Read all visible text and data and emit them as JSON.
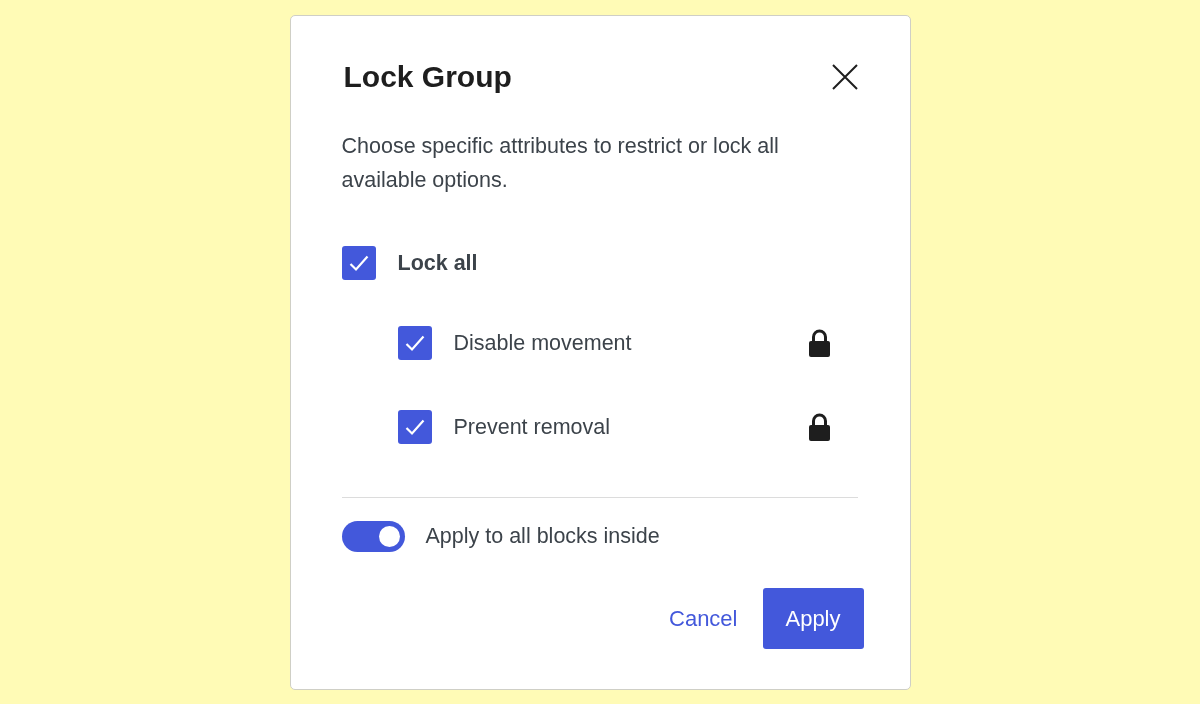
{
  "dialog": {
    "title": "Lock Group",
    "description": "Choose specific attributes to restrict or lock all available options."
  },
  "lock_all": {
    "label": "Lock all",
    "checked": true,
    "children": [
      {
        "label": "Disable movement",
        "checked": true,
        "locked": true
      },
      {
        "label": "Prevent removal",
        "checked": true,
        "locked": true
      }
    ]
  },
  "apply_to_inner": {
    "label": "Apply to all blocks inside",
    "on": true
  },
  "buttons": [
    {
      "label": "Cancel",
      "kind": "link"
    },
    {
      "label": "Apply",
      "kind": "primary"
    }
  ]
}
